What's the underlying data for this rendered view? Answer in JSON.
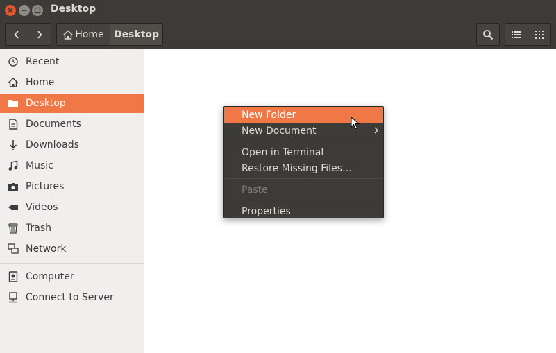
{
  "window": {
    "title": "Desktop"
  },
  "toolbar": {
    "breadcrumbs": [
      {
        "label": "Home",
        "icon": "home-icon"
      },
      {
        "label": "Desktop"
      }
    ]
  },
  "sidebar": {
    "items": [
      {
        "label": "Recent",
        "icon": "clock-icon"
      },
      {
        "label": "Home",
        "icon": "home-icon"
      },
      {
        "label": "Desktop",
        "icon": "folder-icon",
        "active": true
      },
      {
        "label": "Documents",
        "icon": "document-icon"
      },
      {
        "label": "Downloads",
        "icon": "download-icon"
      },
      {
        "label": "Music",
        "icon": "music-icon"
      },
      {
        "label": "Pictures",
        "icon": "camera-icon"
      },
      {
        "label": "Videos",
        "icon": "video-icon"
      },
      {
        "label": "Trash",
        "icon": "trash-icon"
      },
      {
        "label": "Network",
        "icon": "network-icon"
      }
    ],
    "devices": [
      {
        "label": "Computer",
        "icon": "computer-icon"
      },
      {
        "label": "Connect to Server",
        "icon": "server-icon"
      }
    ]
  },
  "context_menu": {
    "items": [
      {
        "label": "New Folder",
        "state": "hover"
      },
      {
        "label": "New Document",
        "submenu": true
      },
      {
        "label": "Open in Terminal"
      },
      {
        "label": "Restore Missing Files…"
      },
      {
        "label": "Paste",
        "state": "disabled"
      },
      {
        "label": "Properties"
      }
    ]
  },
  "colors": {
    "accent": "#f07746",
    "titlebar": "#3c3b37",
    "sidebar_bg": "#f0efed"
  }
}
